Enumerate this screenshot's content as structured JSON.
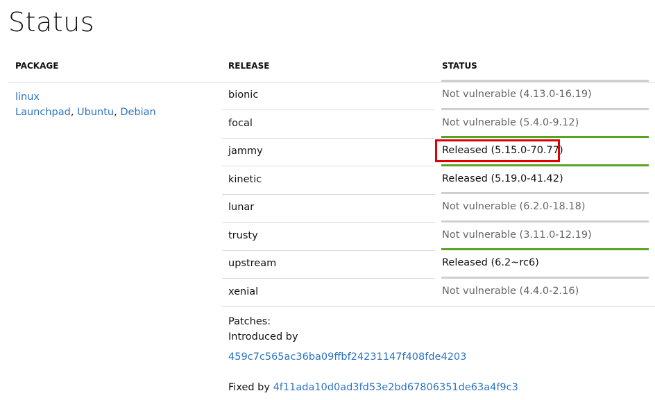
{
  "page": {
    "title": "Status"
  },
  "table": {
    "headers": {
      "package": "PACKAGE",
      "release": "RELEASE",
      "status": "STATUS"
    },
    "package": {
      "name": "linux",
      "links": [
        "Launchpad",
        "Ubuntu",
        "Debian"
      ],
      "separator": ", "
    },
    "rows": [
      {
        "release": "bionic",
        "status": "Not vulnerable (4.13.0-16.19)",
        "kind": "not-vulnerable"
      },
      {
        "release": "focal",
        "status": "Not vulnerable (5.4.0-9.12)",
        "kind": "not-vulnerable"
      },
      {
        "release": "jammy",
        "status": "Released (5.15.0-70.77)",
        "kind": "released",
        "highlighted": true
      },
      {
        "release": "kinetic",
        "status": "Released (5.19.0-41.42)",
        "kind": "released"
      },
      {
        "release": "lunar",
        "status": "Not vulnerable (6.2.0-18.18)",
        "kind": "not-vulnerable"
      },
      {
        "release": "trusty",
        "status": "Not vulnerable (3.11.0-12.19)",
        "kind": "not-vulnerable"
      },
      {
        "release": "upstream",
        "status": "Released (6.2~rc6)",
        "kind": "released"
      },
      {
        "release": "xenial",
        "status": "Not vulnerable (4.4.0-2.16)",
        "kind": "not-vulnerable"
      }
    ]
  },
  "patches": {
    "label": "Patches:",
    "introduced_by_label": "Introduced by",
    "introduced_hash": "459c7c565ac36ba09ffbf24231147f408fde4203",
    "fixed_by_label": "Fixed by",
    "fixed_hash": "4f11ada10d0ad3fd53e2bd67806351de63a4f9c3"
  },
  "colors": {
    "link": "#2b73c2",
    "released_bar": "#59a322",
    "not_vulnerable_bar": "#cfcfcf",
    "highlight": "#e00000",
    "muted_text": "#666666"
  }
}
